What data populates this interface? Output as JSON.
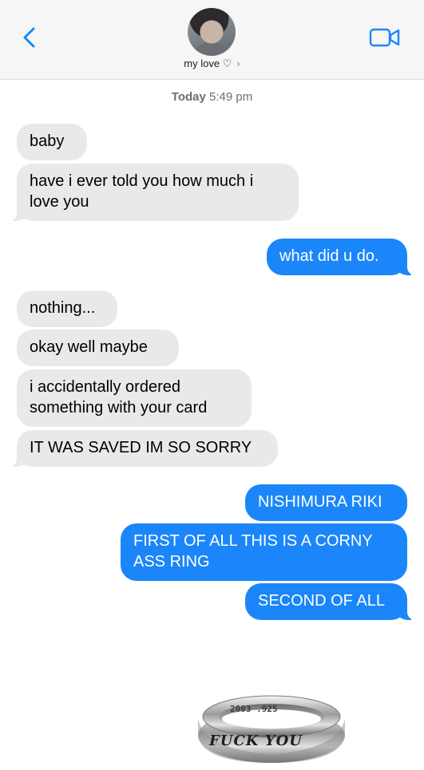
{
  "header": {
    "contact_name": "my love ♡",
    "chevron": "›",
    "icons": {
      "back": "chevron-left-icon",
      "video": "video-camera-icon"
    },
    "accent_color": "#1b86f9"
  },
  "timestamp": {
    "day": "Today",
    "time": "5:49 pm"
  },
  "messages": [
    {
      "direction": "incoming",
      "text": "baby"
    },
    {
      "direction": "incoming",
      "text": "have i ever told you how much i love you"
    },
    {
      "direction": "outgoing",
      "text": "what did u do."
    },
    {
      "direction": "incoming",
      "text": "nothing..."
    },
    {
      "direction": "incoming",
      "text": "okay well maybe"
    },
    {
      "direction": "incoming",
      "text": "i accidentally ordered something with your card"
    },
    {
      "direction": "incoming",
      "text": "IT WAS SAVED IM SO SORRY"
    },
    {
      "direction": "outgoing",
      "text": "NISHIMURA RIKI"
    },
    {
      "direction": "outgoing",
      "text": "FIRST OF ALL THIS IS A CORNY ASS RING"
    },
    {
      "direction": "outgoing",
      "text": "SECOND OF ALL"
    }
  ],
  "ring_image": {
    "engraving": "FUCK YOU",
    "numbers": "2003 .925"
  },
  "colors": {
    "incoming_bubble": "#e9e9eb",
    "outgoing_bubble": "#1b86f9",
    "header_bg": "#f6f6f6"
  }
}
